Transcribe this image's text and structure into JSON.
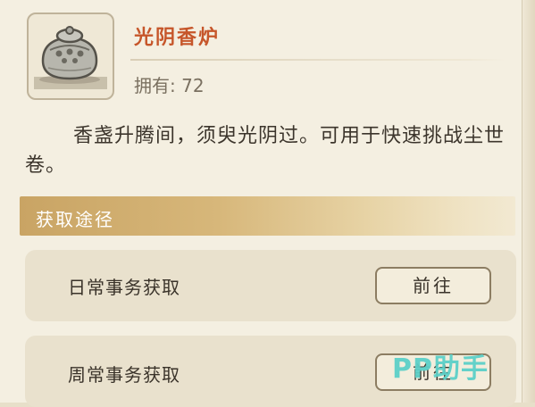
{
  "item": {
    "name": "光阴香炉",
    "owned_label": "拥有: 72",
    "description": "香盏升腾间，须臾光阴过。可用于快速挑战尘世卷。",
    "icon": "incense-burner-icon"
  },
  "acquire": {
    "section_title": "获取途径",
    "methods": [
      {
        "label": "日常事务获取",
        "button": "前往"
      },
      {
        "label": "周常事务获取",
        "button": "前往"
      }
    ]
  },
  "watermark": "PP助手",
  "colors": {
    "name": "#c6562a",
    "section_bar": "#c9a464",
    "watermark": "#5cd0c8",
    "panel": "#f4efe1"
  }
}
